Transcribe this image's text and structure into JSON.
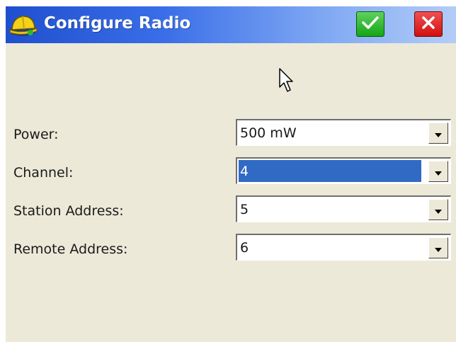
{
  "window": {
    "title": "Configure Radio"
  },
  "title_buttons": {
    "ok": "check-icon",
    "cancel": "close-icon"
  },
  "form": {
    "rows": [
      {
        "label": "Power:",
        "value": "500 mW"
      },
      {
        "label": "Channel:",
        "value": "4"
      },
      {
        "label": "Station Address:",
        "value": "5"
      },
      {
        "label": "Remote Address:",
        "value": "6"
      }
    ]
  },
  "colors": {
    "titlebar": "#2458d8",
    "window_bg": "#ece9d8",
    "selection": "#316ac5",
    "ok_button": "#18a818",
    "cancel_button": "#d81414"
  }
}
